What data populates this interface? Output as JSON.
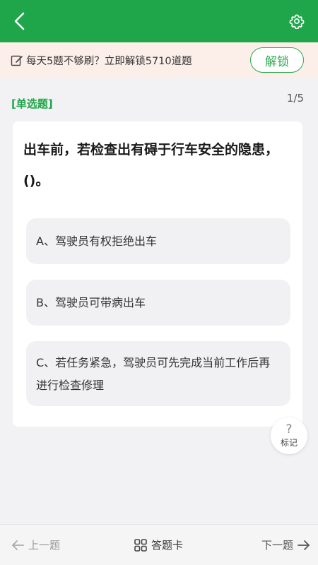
{
  "header": {
    "back_icon": "chevron-left-icon",
    "settings_icon": "gear-icon",
    "accent_color": "#1fa64a"
  },
  "promo": {
    "icon": "edit-icon",
    "text": "每天5题不够刷？立即解锁5710道题",
    "unlock_label": "解锁"
  },
  "quiz": {
    "type_label": "[单选题]",
    "progress": "1/5",
    "question": "出车前，若检查出有碍于行车安全的隐患，()。",
    "options": [
      {
        "text": "A、驾驶员有权拒绝出车"
      },
      {
        "text": "B、驾驶员可带病出车"
      },
      {
        "text": "C、若任务紧急，驾驶员可先完成当前工作后再进行检查修理"
      }
    ]
  },
  "mark": {
    "icon_glyph": "?",
    "label": "标记"
  },
  "bottom_nav": {
    "prev_label": "上一题",
    "answer_card_label": "答题卡",
    "next_label": "下一题"
  }
}
